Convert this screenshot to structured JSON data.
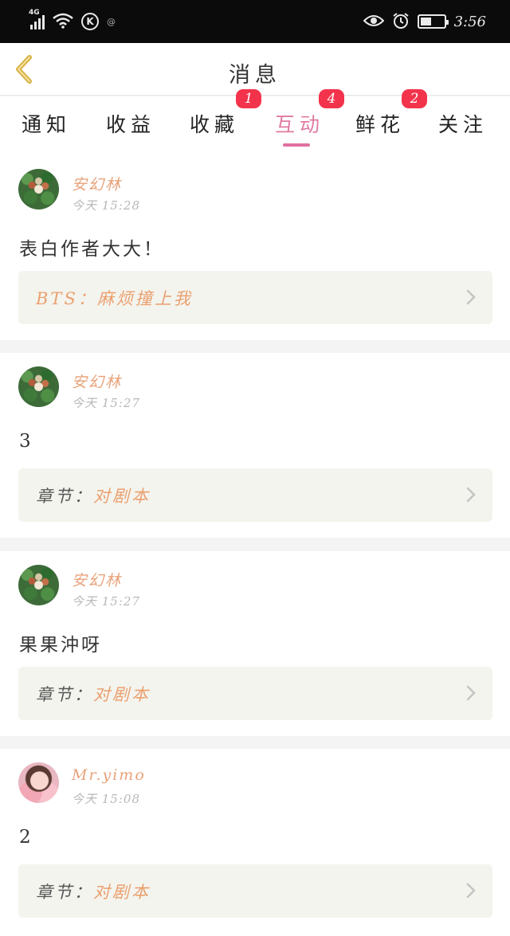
{
  "status_bar": {
    "network": "4G",
    "small_indicator": "@",
    "time": "3:56",
    "battery_level": 0.45
  },
  "nav": {
    "title": "消息"
  },
  "tabs": [
    {
      "label": "通知",
      "badge": null,
      "active": false
    },
    {
      "label": "收益",
      "badge": null,
      "active": false
    },
    {
      "label": "收藏",
      "badge": "1",
      "active": false
    },
    {
      "label": "互动",
      "badge": "4",
      "active": true
    },
    {
      "label": "鲜花",
      "badge": "2",
      "active": false
    },
    {
      "label": "关注",
      "badge": null,
      "active": false
    }
  ],
  "posts": [
    {
      "user": "安幻林",
      "time": "今天 15:28",
      "text": "表白作者大大！",
      "link_prefix": "",
      "link_value": "BTS：麻烦撞上我",
      "avatar": "plant-avatar"
    },
    {
      "user": "安幻林",
      "time": "今天 15:27",
      "text": "3",
      "link_prefix": "章节：",
      "link_value": "对剧本",
      "avatar": "plant-avatar"
    },
    {
      "user": "安幻林",
      "time": "今天 15:27",
      "text": "果果沖呀",
      "link_prefix": "章节：",
      "link_value": "对剧本",
      "avatar": "plant-avatar"
    },
    {
      "user": "Mr.yimo",
      "time": "今天 15:08",
      "text": "2",
      "link_prefix": "章节：",
      "link_value": "对剧本",
      "avatar": "girl-avatar"
    }
  ],
  "colors": {
    "accent_pink": "#e07aa2",
    "badge_red": "#f2334b",
    "link_orange": "#eaa070",
    "name_orange": "#e8a27a",
    "back_arrow": "#d9b347"
  }
}
